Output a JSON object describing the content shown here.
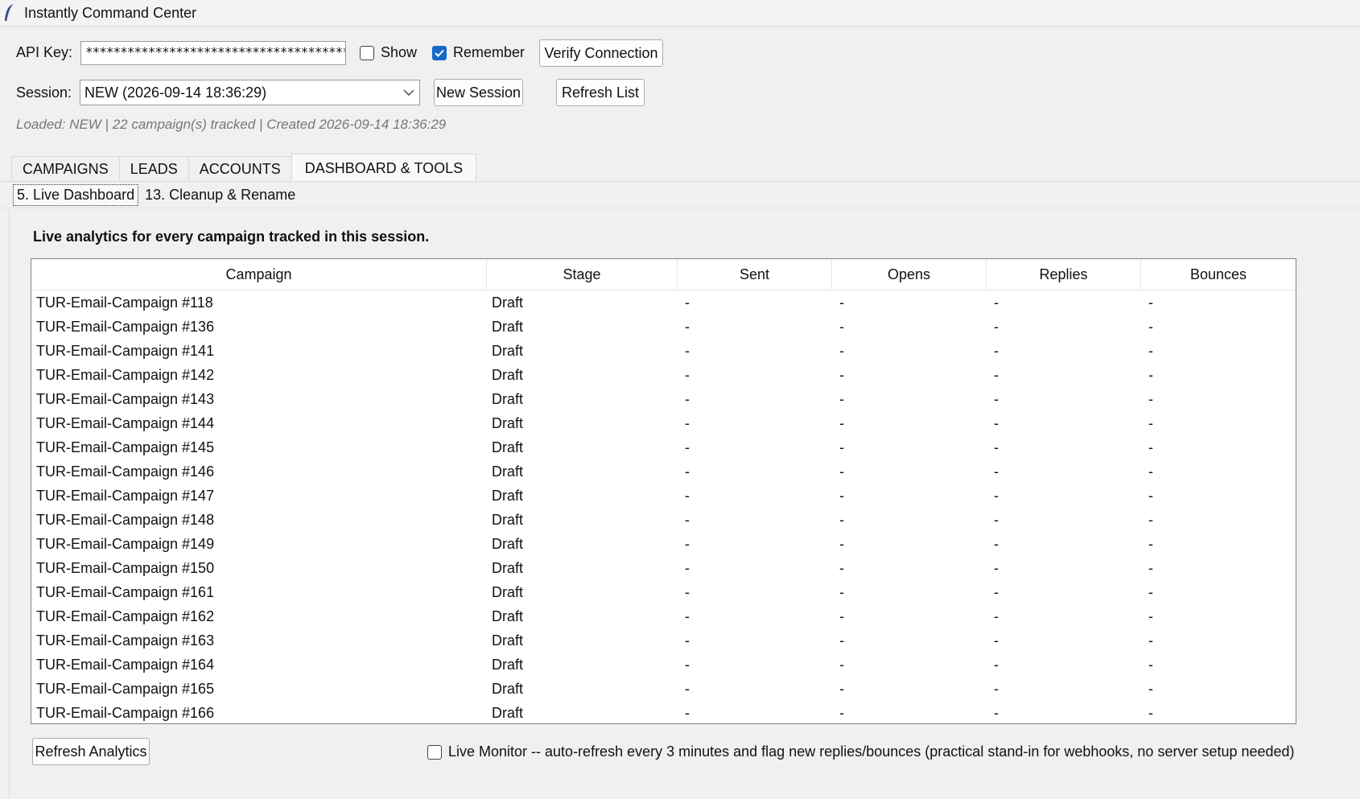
{
  "window": {
    "title": "Instantly Command Center",
    "icon": "feather-icon"
  },
  "api": {
    "label": "API Key:",
    "value": "****************************************",
    "show_label": "Show",
    "show_checked": false,
    "remember_label": "Remember",
    "remember_checked": true,
    "verify_label": "Verify Connection"
  },
  "session": {
    "label": "Session:",
    "selected": "NEW  (2026-09-14 18:36:29)",
    "new_label": "New Session",
    "refresh_label": "Refresh List",
    "status": "Loaded: NEW  |  22 campaign(s) tracked  |  Created 2026-09-14 18:36:29"
  },
  "tabs": [
    {
      "label": "CAMPAIGNS",
      "active": false
    },
    {
      "label": "LEADS",
      "active": false
    },
    {
      "label": "ACCOUNTS",
      "active": false
    },
    {
      "label": "DASHBOARD & TOOLS",
      "active": true
    }
  ],
  "subtabs": [
    {
      "label": "5. Live Dashboard",
      "active": true
    },
    {
      "label": "13. Cleanup & Rename",
      "active": false
    }
  ],
  "dashboard": {
    "heading": "Live analytics for every campaign tracked in this session.",
    "columns": [
      "Campaign",
      "Stage",
      "Sent",
      "Opens",
      "Replies",
      "Bounces"
    ],
    "rows": [
      [
        "TUR-Email-Campaign #118",
        "Draft",
        "-",
        "-",
        "-",
        "-"
      ],
      [
        "TUR-Email-Campaign #136",
        "Draft",
        "-",
        "-",
        "-",
        "-"
      ],
      [
        "TUR-Email-Campaign #141",
        "Draft",
        "-",
        "-",
        "-",
        "-"
      ],
      [
        "TUR-Email-Campaign #142",
        "Draft",
        "-",
        "-",
        "-",
        "-"
      ],
      [
        "TUR-Email-Campaign #143",
        "Draft",
        "-",
        "-",
        "-",
        "-"
      ],
      [
        "TUR-Email-Campaign #144",
        "Draft",
        "-",
        "-",
        "-",
        "-"
      ],
      [
        "TUR-Email-Campaign #145",
        "Draft",
        "-",
        "-",
        "-",
        "-"
      ],
      [
        "TUR-Email-Campaign #146",
        "Draft",
        "-",
        "-",
        "-",
        "-"
      ],
      [
        "TUR-Email-Campaign #147",
        "Draft",
        "-",
        "-",
        "-",
        "-"
      ],
      [
        "TUR-Email-Campaign #148",
        "Draft",
        "-",
        "-",
        "-",
        "-"
      ],
      [
        "TUR-Email-Campaign #149",
        "Draft",
        "-",
        "-",
        "-",
        "-"
      ],
      [
        "TUR-Email-Campaign #150",
        "Draft",
        "-",
        "-",
        "-",
        "-"
      ],
      [
        "TUR-Email-Campaign #161",
        "Draft",
        "-",
        "-",
        "-",
        "-"
      ],
      [
        "TUR-Email-Campaign #162",
        "Draft",
        "-",
        "-",
        "-",
        "-"
      ],
      [
        "TUR-Email-Campaign #163",
        "Draft",
        "-",
        "-",
        "-",
        "-"
      ],
      [
        "TUR-Email-Campaign #164",
        "Draft",
        "-",
        "-",
        "-",
        "-"
      ],
      [
        "TUR-Email-Campaign #165",
        "Draft",
        "-",
        "-",
        "-",
        "-"
      ],
      [
        "TUR-Email-Campaign #166",
        "Draft",
        "-",
        "-",
        "-",
        "-"
      ]
    ],
    "refresh_label": "Refresh Analytics",
    "monitor_label": "Live Monitor -- auto-refresh every 3 minutes and flag new replies/bounces (practical stand-in for webhooks, no server setup needed)",
    "monitor_checked": false
  },
  "colors": {
    "accent": "#1668c8",
    "background": "#f0f0f0"
  }
}
